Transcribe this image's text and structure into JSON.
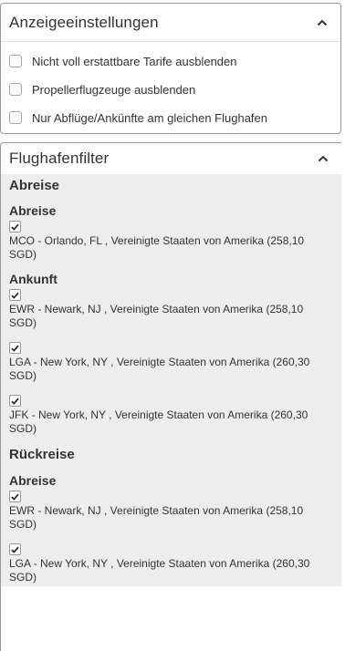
{
  "display_settings": {
    "title": "Anzeigeeinstellungen",
    "options": [
      "Nicht voll erstattbare Tarife ausblenden",
      "Propellerflugzeuge ausblenden",
      "Nur Abflüge/Ankünfte am gleichen Flughafen"
    ]
  },
  "airport_filter": {
    "title": "Flughafenfilter",
    "outbound": {
      "title": "Abreise",
      "departure": {
        "title": "Abreise",
        "airports": [
          {
            "label": "MCO - Orlando, FL , Vereinigte Staaten von Amerika (258,10 SGD)",
            "checked": true
          }
        ]
      },
      "arrival": {
        "title": "Ankunft",
        "airports": [
          {
            "label": "EWR - Newark, NJ , Vereinigte Staaten von Amerika (258,10 SGD)",
            "checked": true
          },
          {
            "label": "LGA - New York, NY , Vereinigte Staaten von Amerika (260,30 SGD)",
            "checked": true
          },
          {
            "label": "JFK - New York, NY , Vereinigte Staaten von Amerika (260,30 SGD)",
            "checked": true
          }
        ]
      }
    },
    "return": {
      "title": "Rückreise",
      "departure": {
        "title": "Abreise",
        "airports": [
          {
            "label": "EWR - Newark, NJ , Vereinigte Staaten von Amerika (258,10 SGD)",
            "checked": true
          },
          {
            "label": "LGA - New York, NY , Vereinigte Staaten von Amerika (260,30 SGD)",
            "checked": true
          }
        ]
      }
    }
  },
  "icons": {
    "collapse": "chevron-up-icon",
    "checkbox": "checkmark-icon"
  }
}
